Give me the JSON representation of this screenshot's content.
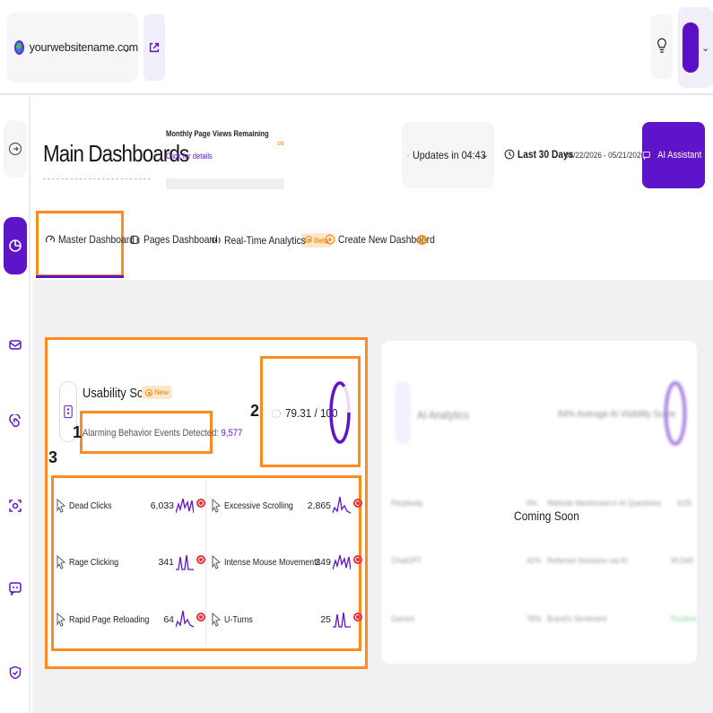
{
  "topbar": {
    "site_name": "yourwebsitename.com"
  },
  "header": {
    "title": "Main Dashboards",
    "page_views_title": "Monthly Page Views Remaining",
    "page_views_link": "Click for details",
    "page_views_value": "∞",
    "updates_label": "Updates in 04:43",
    "period_label": "Last 30 Days",
    "date_range": "04/22/2026 - 05/21/2026",
    "ai_assistant_label": "AI Assistant"
  },
  "tabs": [
    {
      "label": "Master Dashboard",
      "active": true
    },
    {
      "label": "Pages Dashboard"
    },
    {
      "label": "Real-Time Analytics",
      "badge": "Beta"
    },
    {
      "label": "Create New Dashboard"
    }
  ],
  "usability": {
    "title": "Usability Score",
    "badge": "New",
    "alarm_label": "Alarming Behavior Events Detected:",
    "alarm_count": "9,577",
    "score_text": "79.31 / 100",
    "score_fraction": 0.7931,
    "metrics": [
      {
        "name": "Dead Clicks",
        "value": "6,033"
      },
      {
        "name": "Excessive Scrolling",
        "value": "2,865"
      },
      {
        "name": "Rage Clicking",
        "value": "341"
      },
      {
        "name": "Intense Mouse Movements",
        "value": "249"
      },
      {
        "name": "Rapid Page Reloading",
        "value": "64"
      },
      {
        "name": "U-Turns",
        "value": "25"
      }
    ]
  },
  "annotations": [
    "1",
    "2",
    "3"
  ],
  "ai_analytics": {
    "title": "AI Analytics",
    "visibility_text": "84% Average AI Visibility Score",
    "coming_soon": "Coming Soon",
    "left_rows": [
      {
        "name": "Perplexity",
        "value": "0%"
      },
      {
        "name": "ChatGPT",
        "value": "42%"
      },
      {
        "name": "Gemini",
        "value": "78%"
      }
    ],
    "right_rows": [
      {
        "name": "Website Mentioned in AI Questions",
        "value": "5/25"
      },
      {
        "name": "Referred Sessions via AI",
        "value": "90,540"
      },
      {
        "name": "Brand's Sentiment",
        "value": "Positive"
      }
    ]
  },
  "colors": {
    "brand": "#5e14c8",
    "highlight": "#ff8a1e",
    "alert": "#e8323d"
  }
}
